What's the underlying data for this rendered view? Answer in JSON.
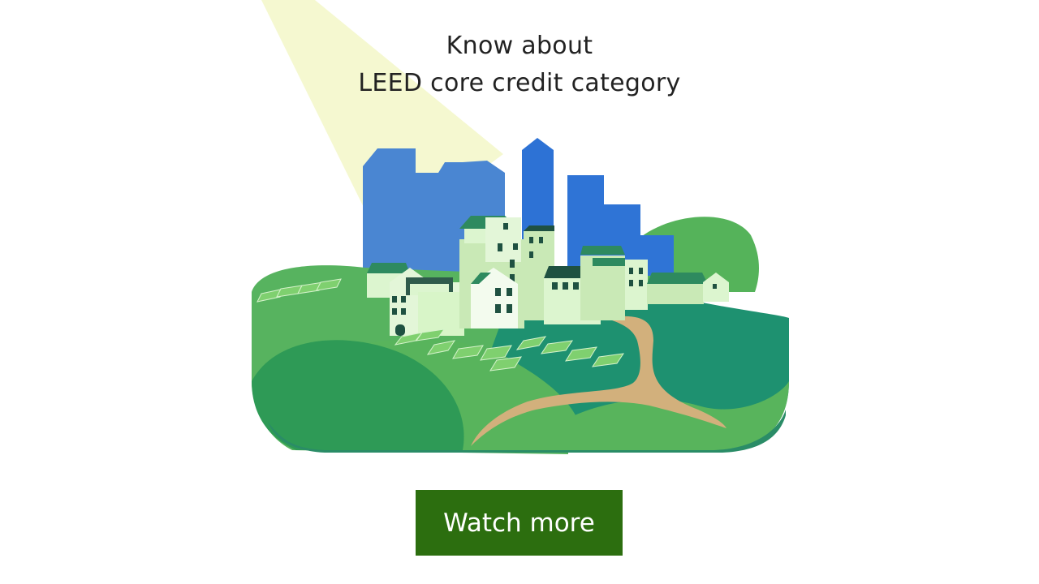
{
  "headline": {
    "line1": "Know about",
    "line2": "LEED core credit category"
  },
  "illustration": {
    "name": "green-city-illustration"
  },
  "cta": {
    "label": "Watch more"
  },
  "colors": {
    "background": "#ffffff",
    "headline_text": "#222222",
    "button": "#2c6e0f",
    "button_text": "#ffffff",
    "hill_light": "#5db55d",
    "hill_dark": "#1e9170",
    "tower_blue": "#2f74d6",
    "house_light": "#dcf5cf",
    "roof_green": "#2e8a5f",
    "path_tan": "#d2b07c",
    "light_beam": "#f3f7c8"
  }
}
